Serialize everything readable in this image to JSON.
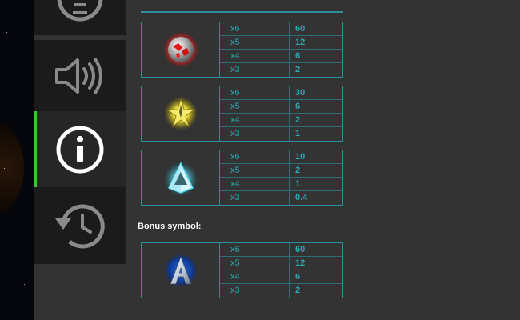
{
  "sidebar": {
    "buttons": [
      {
        "name": "zoom-out-button",
        "icon": "minus-circle-icon",
        "active": false
      },
      {
        "name": "sound-button",
        "icon": "speaker-icon",
        "active": false
      },
      {
        "name": "info-button",
        "icon": "info-icon",
        "active": true
      },
      {
        "name": "history-button",
        "icon": "history-icon",
        "active": false
      }
    ],
    "active_color": "#3ec23e"
  },
  "paytable": {
    "groups": [
      {
        "symbol": "red-planet-symbol-icon",
        "rows": [
          {
            "mult": "x6",
            "pay": "60"
          },
          {
            "mult": "x5",
            "pay": "12"
          },
          {
            "mult": "x4",
            "pay": "6"
          },
          {
            "mult": "x3",
            "pay": "2"
          }
        ]
      },
      {
        "symbol": "yellow-star-symbol-icon",
        "rows": [
          {
            "mult": "x6",
            "pay": "30"
          },
          {
            "mult": "x5",
            "pay": "6"
          },
          {
            "mult": "x4",
            "pay": "2"
          },
          {
            "mult": "x3",
            "pay": "1"
          }
        ]
      },
      {
        "symbol": "cyan-pyramid-symbol-icon",
        "rows": [
          {
            "mult": "x6",
            "pay": "10"
          },
          {
            "mult": "x5",
            "pay": "2"
          },
          {
            "mult": "x4",
            "pay": "1"
          },
          {
            "mult": "x3",
            "pay": "0.4"
          }
        ]
      }
    ],
    "bonus_label": "Bonus symbol:",
    "bonus": {
      "symbol": "blue-a-bonus-symbol-icon",
      "rows": [
        {
          "mult": "x6",
          "pay": "60"
        },
        {
          "mult": "x5",
          "pay": "12"
        },
        {
          "mult": "x4",
          "pay": "6"
        },
        {
          "mult": "x3",
          "pay": "2"
        }
      ]
    },
    "accent_color": "#2ca7b3",
    "border_color": "#2c8f99"
  }
}
